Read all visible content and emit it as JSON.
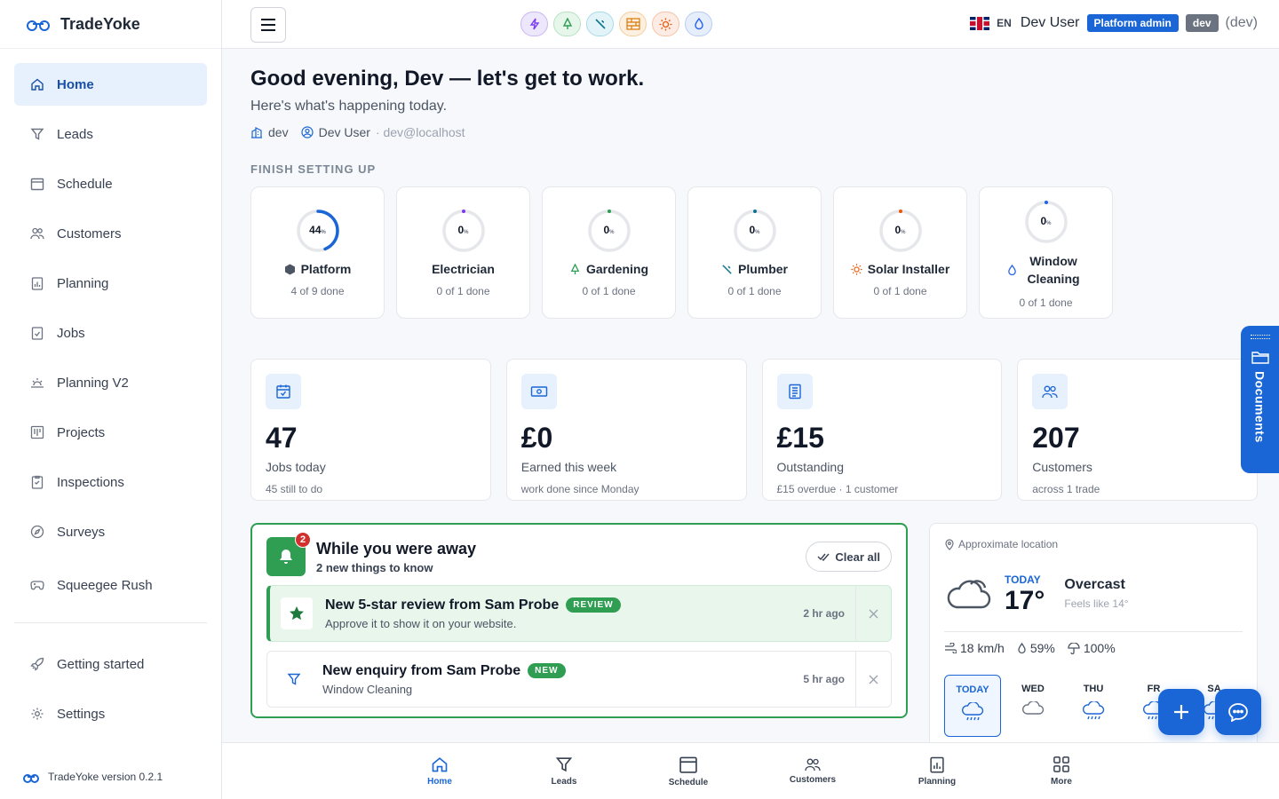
{
  "brand": {
    "name": "TradeYoke",
    "version_text": "TradeYoke version 0.2.1",
    "color": "#1a66d6"
  },
  "sidebar": {
    "items": [
      {
        "label": "Home",
        "icon": "home-icon",
        "active": true
      },
      {
        "label": "Leads",
        "icon": "filter-icon"
      },
      {
        "label": "Schedule",
        "icon": "calendar-icon"
      },
      {
        "label": "Customers",
        "icon": "users-icon"
      },
      {
        "label": "Planning",
        "icon": "clipboard-chart-icon"
      },
      {
        "label": "Jobs",
        "icon": "clipboard-check-icon"
      },
      {
        "label": "Planning V2",
        "icon": "sunrise-icon"
      },
      {
        "label": "Projects",
        "icon": "kanban-icon"
      },
      {
        "label": "Inspections",
        "icon": "clipboard-icon"
      },
      {
        "label": "Surveys",
        "icon": "compass-icon"
      },
      {
        "label": "Squeegee Rush",
        "icon": "gamepad-icon"
      }
    ],
    "footer_items": [
      {
        "label": "Getting started",
        "icon": "rocket-icon"
      },
      {
        "label": "Settings",
        "icon": "gear-icon"
      }
    ]
  },
  "topbar": {
    "trade_icons": [
      {
        "name": "lightning-icon",
        "bg": "#ede7fb",
        "border": "#c9b8f2",
        "color": "#7c3aed"
      },
      {
        "name": "tree-icon",
        "bg": "#e6f6ea",
        "border": "#b6e2c1",
        "color": "#2f9e53"
      },
      {
        "name": "wrench-icon",
        "bg": "#e3f4f8",
        "border": "#a9dbe8",
        "color": "#0e7490"
      },
      {
        "name": "bricks-icon",
        "bg": "#fdf0e1",
        "border": "#f3cf9f",
        "color": "#d97706"
      },
      {
        "name": "sun-icon",
        "bg": "#fdece4",
        "border": "#f6c2a8",
        "color": "#ea580c"
      },
      {
        "name": "drop-icon",
        "bg": "#e6eefc",
        "border": "#b7cbf3",
        "color": "#2563eb"
      }
    ],
    "lang": "EN",
    "user_name": "Dev User",
    "role_badge": "Platform admin",
    "env_badge": "dev",
    "env_text": "(dev)"
  },
  "greeting": {
    "title": "Good evening, Dev — let's get to work.",
    "subtitle": "Here's what's happening today.",
    "org": "dev",
    "user": "Dev User",
    "email": "· dev@localhost"
  },
  "setup": {
    "title": "FINISH SETTING UP",
    "cards": [
      {
        "name": "Platform",
        "percent": "44",
        "fraction": 0.44,
        "progress": "4 of 9 done",
        "icon": "hexagon-icon",
        "color": "#1a66d6"
      },
      {
        "name": "Electrician",
        "percent": "0",
        "fraction": 0,
        "progress": "0 of 1 done",
        "icon": "",
        "color": "#7c3aed"
      },
      {
        "name": "Gardening",
        "percent": "0",
        "fraction": 0,
        "progress": "0 of 1 done",
        "icon": "tree-icon",
        "color": "#2f9e53"
      },
      {
        "name": "Plumber",
        "percent": "0",
        "fraction": 0,
        "progress": "0 of 1 done",
        "icon": "wrench-icon",
        "color": "#0e7490"
      },
      {
        "name": "Solar Installer",
        "percent": "0",
        "fraction": 0,
        "progress": "0 of 1 done",
        "icon": "sun-icon",
        "color": "#ea580c"
      },
      {
        "name": "Window Cleaning",
        "percent": "0",
        "fraction": 0,
        "progress": "0 of 1 done",
        "icon": "drop-icon",
        "color": "#2563eb"
      }
    ],
    "percent_symbol": "%"
  },
  "stats": [
    {
      "value": "47",
      "label": "Jobs today",
      "sub": "45 still to do",
      "icon": "calendar-check-icon"
    },
    {
      "value": "£0",
      "label": "Earned this week",
      "sub": "work done since Monday",
      "icon": "cash-icon"
    },
    {
      "value": "£15",
      "label": "Outstanding",
      "sub": "£15 overdue · 1 customer",
      "icon": "invoice-icon"
    },
    {
      "value": "207",
      "label": "Customers",
      "sub": "across 1 trade",
      "icon": "users-icon"
    }
  ],
  "away": {
    "title": "While you were away",
    "subtitle": "2 new things to know",
    "count": "2",
    "clear_label": "Clear all",
    "notes": [
      {
        "title": "New 5-star review from Sam Probe",
        "tag": "REVIEW",
        "sub": "Approve it to show it on your website.",
        "time": "2 hr ago"
      },
      {
        "title": "New enquiry from Sam Probe",
        "tag": "NEW",
        "sub": "Window Cleaning",
        "time": "5 hr ago"
      }
    ]
  },
  "weather": {
    "location": "Approximate location",
    "today_label": "TODAY",
    "temp": "17°",
    "condition": "Overcast",
    "feels_like": "Feels like 14°",
    "wind": "18 km/h",
    "humidity": "59%",
    "rain": "100%",
    "days": [
      "TODAY",
      "WED",
      "THU",
      "FR",
      "SA"
    ]
  },
  "bottom_nav": [
    {
      "label": "Home",
      "icon": "home-icon",
      "active": true
    },
    {
      "label": "Leads",
      "icon": "filter-icon"
    },
    {
      "label": "Schedule",
      "icon": "calendar-icon"
    },
    {
      "label": "Customers",
      "icon": "users-icon"
    },
    {
      "label": "Planning",
      "icon": "clipboard-chart-icon"
    },
    {
      "label": "More",
      "icon": "grid-icon"
    }
  ],
  "documents_tab": "Documents"
}
